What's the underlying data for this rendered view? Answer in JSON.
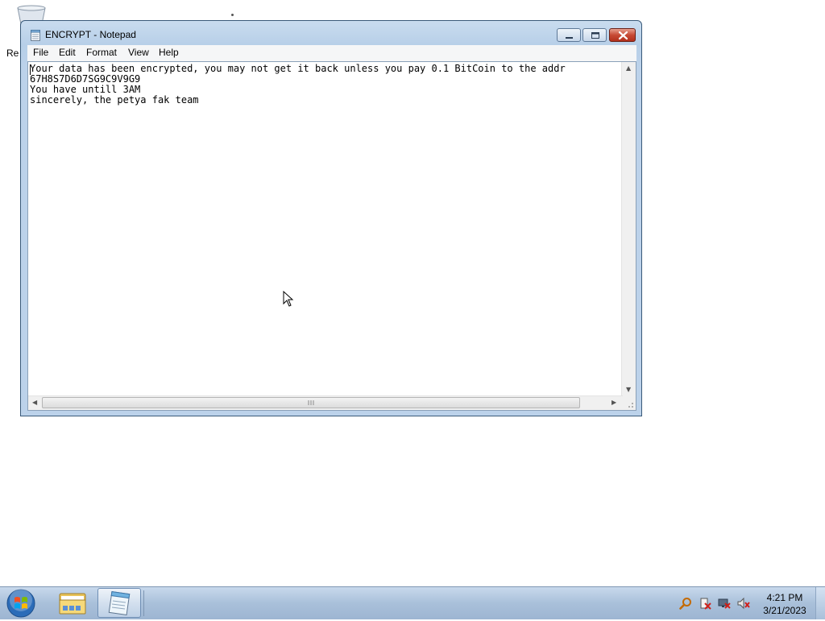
{
  "desktop": {
    "recycle_bin_label": "Re",
    "icons": [
      "recycle-bin-icon"
    ]
  },
  "window": {
    "title": "ENCRYPT - Notepad",
    "icon": "notepad-icon",
    "controls": [
      "minimize-icon",
      "maximize-icon",
      "close-icon"
    ]
  },
  "menu": {
    "file": "File",
    "edit": "Edit",
    "format": "Format",
    "view": "View",
    "help": "Help"
  },
  "document": {
    "lines": [
      "Your data has been encrypted, you may not get it back unless you pay 0.1 BitCoin to the addr",
      "67H8S7D6D7SG9C9V9G9",
      "You have untill 3AM",
      "sincerely, the petya fak team"
    ]
  },
  "taskbar": {
    "start_icon": "windows-start-icon",
    "pinned": [
      "file-explorer-icon",
      "notepad-icon"
    ],
    "tray_icons": [
      "action-center-icon",
      "network-icon",
      "volume-muted-icon",
      "search-icon"
    ],
    "time": "4:21 PM",
    "date": "3/21/2023"
  },
  "colors": {
    "window_frame": "#bcd2ea",
    "close_button": "#c74a35",
    "taskbar": "#a9c0da"
  }
}
